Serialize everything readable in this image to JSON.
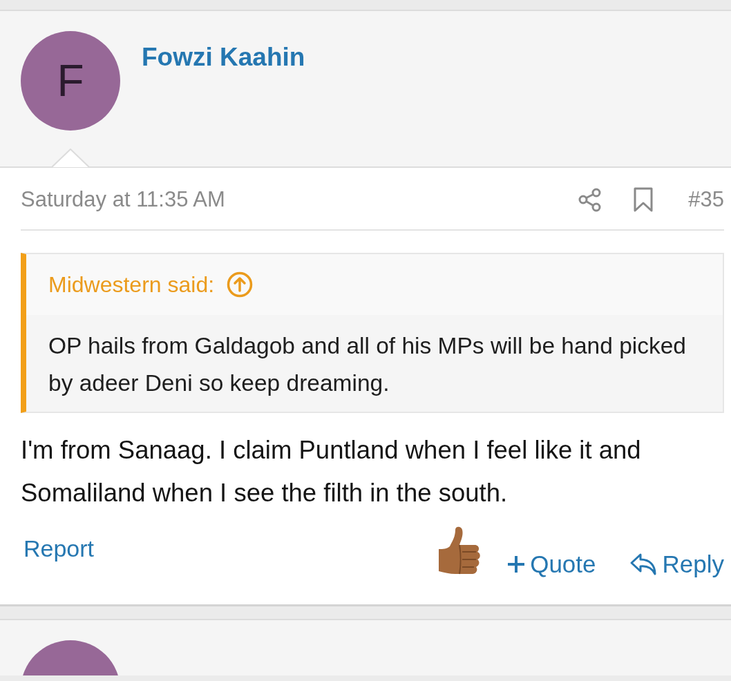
{
  "post": {
    "author": {
      "initial": "F",
      "name": "Fowzi Kaahin"
    },
    "date": "Saturday at 11:35 AM",
    "number": "#35",
    "quote": {
      "source": "Midwestern said:",
      "text": "OP hails from Galdagob and all of his MPs will be hand picked by adeer Deni so keep dreaming."
    },
    "body": "I'm from Sanaag. I claim Puntland when I feel like it and Somaliland when I see the filth in the south.",
    "reactions": [
      {
        "kind": "like"
      }
    ],
    "actions": {
      "report": "Report",
      "quote": "Quote",
      "reply": "Reply"
    }
  }
}
